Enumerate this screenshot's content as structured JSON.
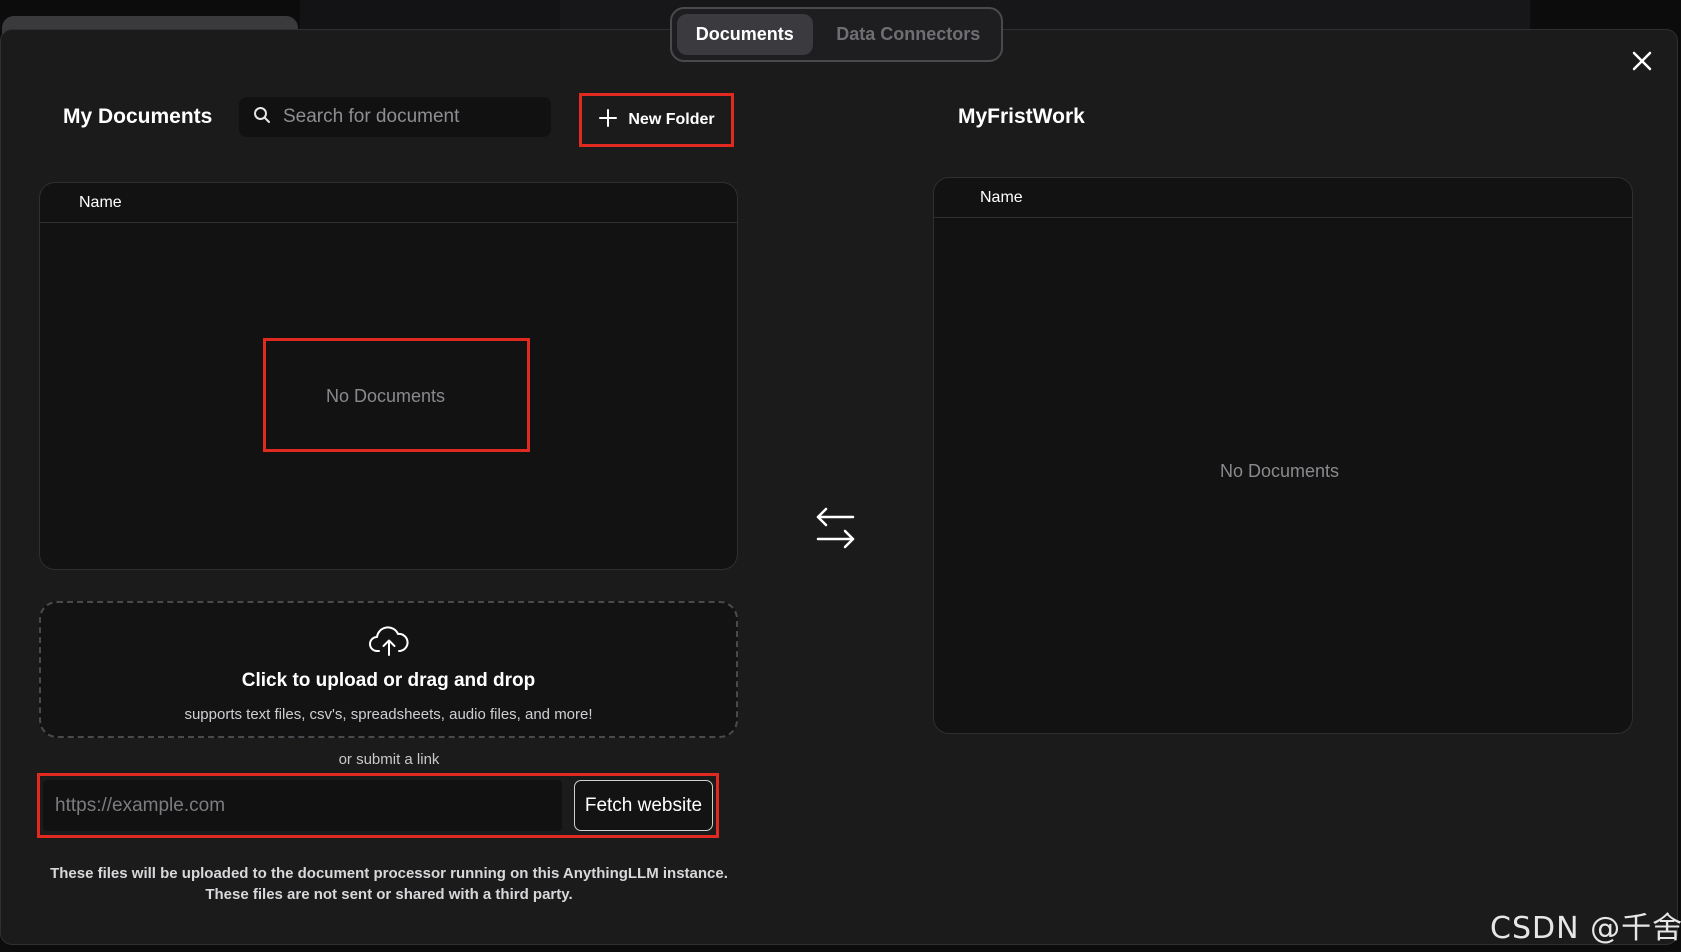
{
  "tabs": [
    {
      "label": "Documents",
      "active": true
    },
    {
      "label": "Data Connectors",
      "active": false
    }
  ],
  "close": {
    "icon": "close-icon"
  },
  "left_panel": {
    "title": "My Documents",
    "search": {
      "placeholder": "Search for document",
      "value": "",
      "icon": "search-icon"
    },
    "new_folder": {
      "label": "New Folder",
      "icon": "plus-icon"
    },
    "table": {
      "column": "Name",
      "empty_text": "No Documents"
    }
  },
  "right_panel": {
    "title": "MyFristWork",
    "table": {
      "column": "Name",
      "empty_text": "No Documents"
    }
  },
  "transfer": {
    "icon": "swap-arrows-icon"
  },
  "upload": {
    "icon": "cloud-upload-icon",
    "title": "Click to upload or drag and drop",
    "subtitle": "supports text files, csv's, spreadsheets, audio files, and more!"
  },
  "link": {
    "or_text": "or submit a link",
    "placeholder": "https://example.com",
    "value": "",
    "button": "Fetch website"
  },
  "disclaimer": {
    "line1": "These files will be uploaded to the document processor running on this AnythingLLM instance.",
    "line2": "These files are not sent or shared with a third party."
  },
  "watermark": "CSDN @千舍",
  "colors": {
    "modal_bg": "#1b1b1c",
    "table_bg": "#121213",
    "highlight_red": "#e02a20",
    "muted_text": "#8a8a8e"
  }
}
